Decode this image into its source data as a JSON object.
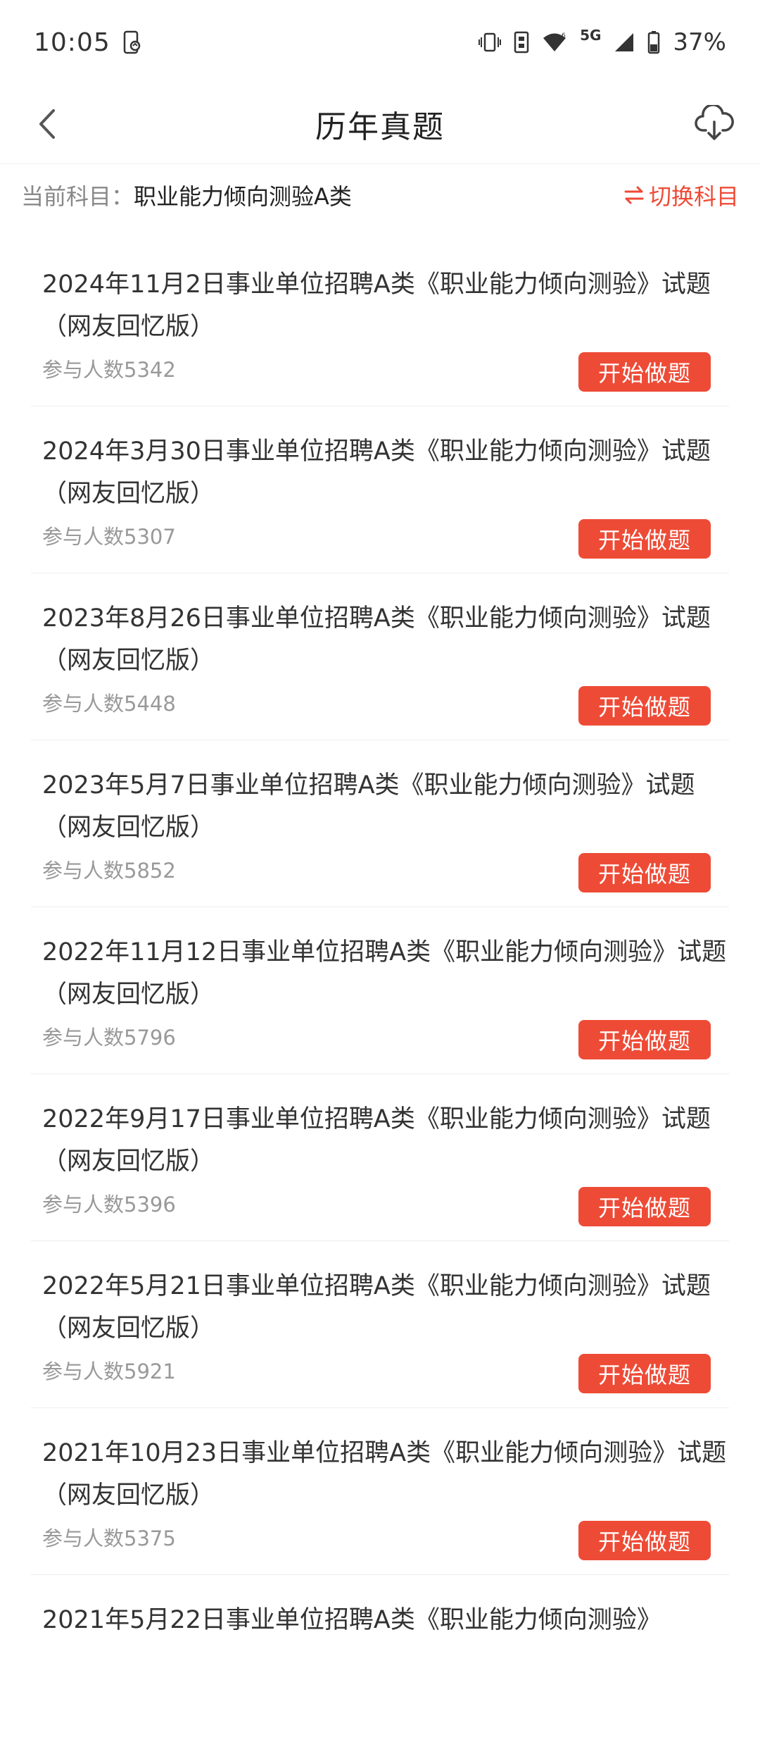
{
  "status_bar": {
    "time": "10:05",
    "network": "5G",
    "battery": "37%"
  },
  "header": {
    "title": "历年真题"
  },
  "subject": {
    "label": "当前科目：",
    "value": "职业能力倾向测验A类",
    "switch_label": "切换科目"
  },
  "colors": {
    "accent": "#ee4b36"
  },
  "exams": [
    {
      "title": "2024年11月2日事业单位招聘A类《职业能力倾向测验》试题（网友回忆版）",
      "count": "参与人数5342",
      "button": "开始做题"
    },
    {
      "title": "2024年3月30日事业单位招聘A类《职业能力倾向测验》试题（网友回忆版）",
      "count": "参与人数5307",
      "button": "开始做题"
    },
    {
      "title": "2023年8月26日事业单位招聘A类《职业能力倾向测验》试题（网友回忆版）",
      "count": "参与人数5448",
      "button": "开始做题"
    },
    {
      "title": "2023年5月7日事业单位招聘A类《职业能力倾向测验》试题（网友回忆版）",
      "count": "参与人数5852",
      "button": "开始做题"
    },
    {
      "title": "2022年11月12日事业单位招聘A类《职业能力倾向测验》试题（网友回忆版）",
      "count": "参与人数5796",
      "button": "开始做题"
    },
    {
      "title": "2022年9月17日事业单位招聘A类《职业能力倾向测验》试题（网友回忆版）",
      "count": "参与人数5396",
      "button": "开始做题"
    },
    {
      "title": "2022年5月21日事业单位招聘A类《职业能力倾向测验》试题（网友回忆版）",
      "count": "参与人数5921",
      "button": "开始做题"
    },
    {
      "title": "2021年10月23日事业单位招聘A类《职业能力倾向测验》试题（网友回忆版）",
      "count": "参与人数5375",
      "button": "开始做题"
    },
    {
      "title": "2021年5月22日事业单位招聘A类《职业能力倾向测验》",
      "count": "",
      "button": ""
    }
  ]
}
